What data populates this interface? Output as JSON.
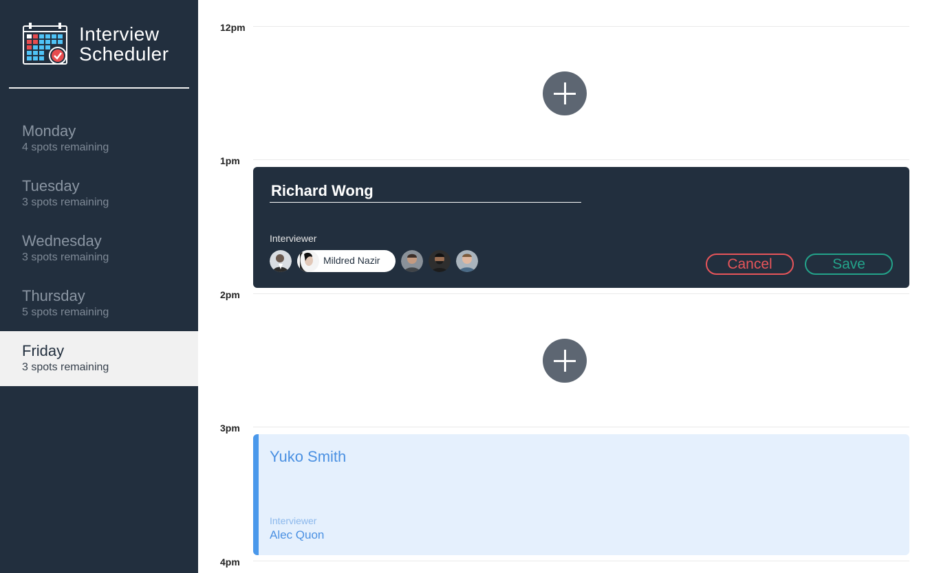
{
  "brand": {
    "line1": "Interview",
    "line2": "Scheduler"
  },
  "days": [
    {
      "name": "Monday",
      "spots": "4 spots remaining",
      "selected": false
    },
    {
      "name": "Tuesday",
      "spots": "3 spots remaining",
      "selected": false
    },
    {
      "name": "Wednesday",
      "spots": "3 spots remaining",
      "selected": false
    },
    {
      "name": "Thursday",
      "spots": "5 spots remaining",
      "selected": false
    },
    {
      "name": "Friday",
      "spots": "3 spots remaining",
      "selected": true
    }
  ],
  "times": [
    "12pm",
    "1pm",
    "2pm",
    "3pm",
    "4pm"
  ],
  "form": {
    "student_name": "Richard Wong",
    "interviewer_label": "Interviewer",
    "selected_interviewer": "Mildred Nazir",
    "cancel_label": "Cancel",
    "save_label": "Save"
  },
  "booked": {
    "student": "Yuko Smith",
    "interviewer_label": "Interviewer",
    "interviewer": "Alec Quon"
  },
  "colors": {
    "sidebar": "#222f3e",
    "cancel": "#e8555a",
    "save": "#23a38a",
    "show_accent": "#4a98eb",
    "show_bg": "#e5f0fd"
  }
}
